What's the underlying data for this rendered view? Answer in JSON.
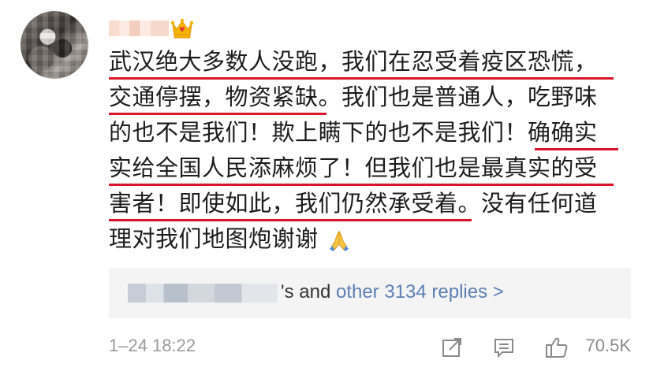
{
  "comment": {
    "lines": [
      "武汉绝大多数人没跑，我们在忍受着疫区恐慌，",
      "交通停摆，物资紧缺。我们也是普通人，吃野味",
      "的也不是我们！欺上瞒下的也不是我们！确确实",
      "实给全国人民添麻烦了！但我们也是最真实的受",
      "害者！即使如此，我们仍然承受着。没有任何道",
      "理对我们地图炮谢谢"
    ],
    "trailing_emoji": "folded-hands-emoji"
  },
  "badge_icon": "crown-icon",
  "replies": {
    "suffix": "'s and",
    "link": "other 3134 replies >"
  },
  "footer": {
    "timestamp": "1–24 18:22",
    "likes": "70.5K",
    "icons": [
      "share-icon",
      "comment-icon",
      "like-icon"
    ]
  },
  "colors": {
    "underline": "#d9142b",
    "link": "#5b7fb4",
    "muted": "#9a9a9a",
    "crown": "#f5b400",
    "reply_bg": "#f4f4f4"
  }
}
